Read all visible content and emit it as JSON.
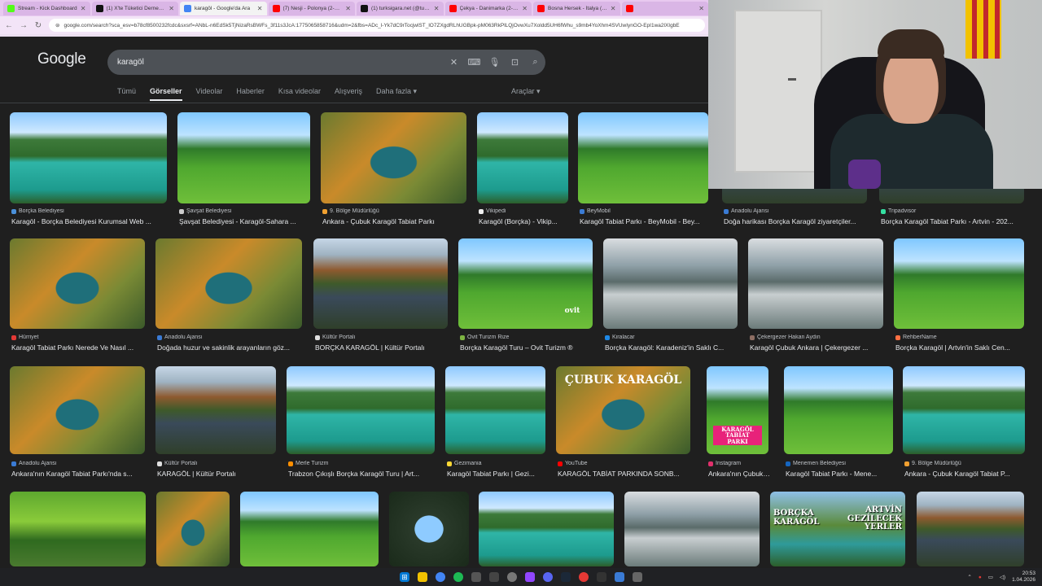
{
  "browser": {
    "tabs": [
      {
        "title": "Stream - Kick Dashboard",
        "color": "#53fc18",
        "active": false
      },
      {
        "title": "(1) X'te Tüketici Derneğinden 'Mi...",
        "color": "#111111",
        "active": false
      },
      {
        "title": "karagöl - Google'da Ara",
        "color": "#4285f4",
        "active": true
      },
      {
        "title": "(7) Nesji - Polonya (2-2) Maç C...",
        "color": "#ff0000",
        "active": false
      },
      {
        "title": "(1) turksigara.net (@turksigara...",
        "color": "#111111",
        "active": false
      },
      {
        "title": "Çekya - Danimarka (2-2) Maç C...",
        "color": "#ff0000",
        "active": false
      },
      {
        "title": "Bosna Hersek - İtalya (1-1) M...",
        "color": "#ff0000",
        "active": false
      },
      {
        "title": "",
        "color": "#ff0000",
        "active": false
      }
    ],
    "url": "google.com/search?sca_esv=b78cf8500232fcdc&sxsrf=ANbL-n6EdSk5TjNizaRsBWFs_3f11s3JcA:1775065858716&udm=2&fbs=ADc_l-Yk7dC9rTocjwlST_lO7ZXgdRLhUGBpk-pM063RkPlLQjOvwXu7Xoldd5UH6fWhu_s9mb4YoXhm4SVUwIynGO-EpI1wa2lXIgbE"
  },
  "google": {
    "logo": "Google",
    "query": "karagöl",
    "tabs": [
      "Tümü",
      "Görseller",
      "Videolar",
      "Haberler",
      "Kısa videolar",
      "Alışveriş",
      "Daha fazla"
    ],
    "tools": "Araçlar"
  },
  "rows": [
    [
      {
        "src": "Borçka Belediyesi",
        "title": "Karagöl - Borçka Belediyesi Kurumsal Web ...",
        "c": "#4a90d9"
      },
      {
        "src": "Şavşat Belediyesi",
        "title": "Şavşat Belediyesi - Karagöl-Sahara ...",
        "c": "#cccccc"
      },
      {
        "src": "9. Bölge Müdürlüğü",
        "title": "Ankara - Çubuk Karagöl Tabiat Parkı",
        "c": "#f0a030"
      },
      {
        "src": "Vikipedi",
        "title": "Karagöl (Borçka) - Vikip...",
        "c": "#eeeeee"
      },
      {
        "src": "BeyMobil",
        "title": "Karagöl Tabiat Parkı - BeyMobil - Bey...",
        "c": "#3a7bd5"
      },
      {
        "src": "Anadolu Ajansı",
        "title": "Doğa harikası Borçka Karagöl ziyaretçiler...",
        "c": "#3a7bd5"
      },
      {
        "src": "Tripadvisor",
        "title": "Borçka Karagöl Tabiat Parkı - Artvin - 202...",
        "c": "#34e0a1"
      }
    ],
    [
      {
        "src": "Hürriyet",
        "title": "Karagöl Tabiat Parkı Nerede Ve Nasıl ...",
        "c": "#e53935"
      },
      {
        "src": "Anadolu Ajansı",
        "title": "Doğada huzur ve sakinlik arayanların göz...",
        "c": "#3a7bd5"
      },
      {
        "src": "Kültür Portalı",
        "title": "BORÇKA KARAGÖL | Kültür Portalı",
        "c": "#e0e0e0"
      },
      {
        "src": "Ovit Turizm Rize",
        "title": "Borçka Karagöl Turu – Ovit Turizm ®",
        "c": "#7cb342"
      },
      {
        "src": "Kiralacar",
        "title": "Borçka Karagöl: Karadeniz'in Saklı C...",
        "c": "#1e88e5"
      },
      {
        "src": "Çekergezer Hakan Aydın",
        "title": "Karagöl Çubuk Ankara | Çekergezer ...",
        "c": "#8d6e63"
      },
      {
        "src": "RehberName",
        "title": "Borçka Karagöl | Artvin'in Saklı Cen...",
        "c": "#ff7043"
      }
    ],
    [
      {
        "src": "Anadolu Ajansı",
        "title": "Ankara'nın Karagöl Tabiat Parkı'nda s...",
        "c": "#3a7bd5"
      },
      {
        "src": "Kültür Portalı",
        "title": "KARAGÖL | Kültür Portalı",
        "c": "#e0e0e0"
      },
      {
        "src": "Merle Turizm",
        "title": "Trabzon Çıkışlı Borçka Karagöl Turu | Art...",
        "c": "#ff8f00"
      },
      {
        "src": "Gezimania",
        "title": "Karagöl Tabiat Parkı | Gezi...",
        "c": "#fdd835"
      },
      {
        "src": "YouTube",
        "title": "KARAGÖL TABİAT PARKINDA SONB...",
        "c": "#ff0000"
      },
      {
        "src": "Instagram",
        "title": "Ankara'nın Çubuk İ...",
        "c": "#e1306c"
      },
      {
        "src": "Menemen Belediyesi",
        "title": "Karagöl Tabiat Parkı - Mene...",
        "c": "#1565c0"
      },
      {
        "src": "9. Bölge Müdürlüğü",
        "title": "Ankara - Çubuk Karagöl Tabiat P...",
        "c": "#f0a030"
      }
    ]
  ],
  "overlay_texts": {
    "cubuk": "ÇUBUK KARAGÖL",
    "tabiat": "KARAGÖL\nTABİAT PARKI",
    "borcka": "BORÇKA\nKARAGÖL",
    "artvin": "ARTVİN\nGEZİLECEK\nYERLER",
    "ovit": "ovit"
  },
  "taskbar": {
    "time": "20:53",
    "date": "1.04.2026"
  }
}
